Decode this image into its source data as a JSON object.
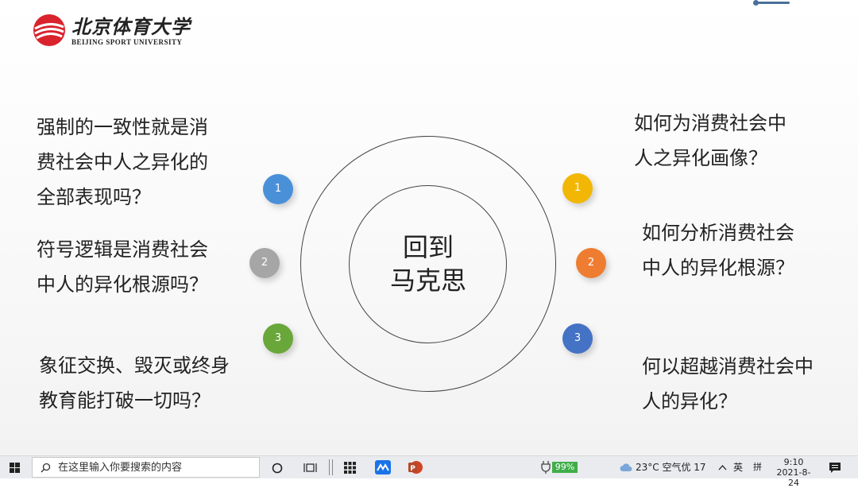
{
  "logo": {
    "cn": "北京体育大学",
    "en": "BEIJING SPORT UNIVERSITY"
  },
  "slide": {
    "center_line1": "回到",
    "center_line2": "马克思",
    "left_questions": [
      {
        "lines": [
          "强制的一致性就是消",
          "费社会中人之异化的",
          "全部表现吗？"
        ]
      },
      {
        "lines": [
          "符号逻辑是消费社会",
          "中人的异化根源吗？"
        ]
      },
      {
        "lines": [
          "象征交换、毁灭或终身",
          "教育能打破一切吗？"
        ]
      }
    ],
    "right_questions": [
      {
        "lines": [
          "如何为消费社会中",
          "人之异化画像？"
        ]
      },
      {
        "lines": [
          "如何分析消费社会",
          "中人的异化根源？"
        ]
      },
      {
        "lines": [
          "何以超越消费社会中",
          "人的异化？"
        ]
      }
    ],
    "left_badges": [
      {
        "num": "1",
        "color": "#4a90d9"
      },
      {
        "num": "2",
        "color": "#a6a6a6"
      },
      {
        "num": "3",
        "color": "#6aa73a"
      }
    ],
    "right_badges": [
      {
        "num": "1",
        "color": "#f2b705"
      },
      {
        "num": "2",
        "color": "#ee7d31"
      },
      {
        "num": "3",
        "color": "#4472c4"
      }
    ]
  },
  "taskbar": {
    "search_placeholder": "在这里输入你要搜索的内容",
    "battery": "99%",
    "weather": "23°C 空气优 17",
    "ime": "英",
    "ime2": "拼",
    "time": "9:10",
    "date": "2021-8-24"
  }
}
